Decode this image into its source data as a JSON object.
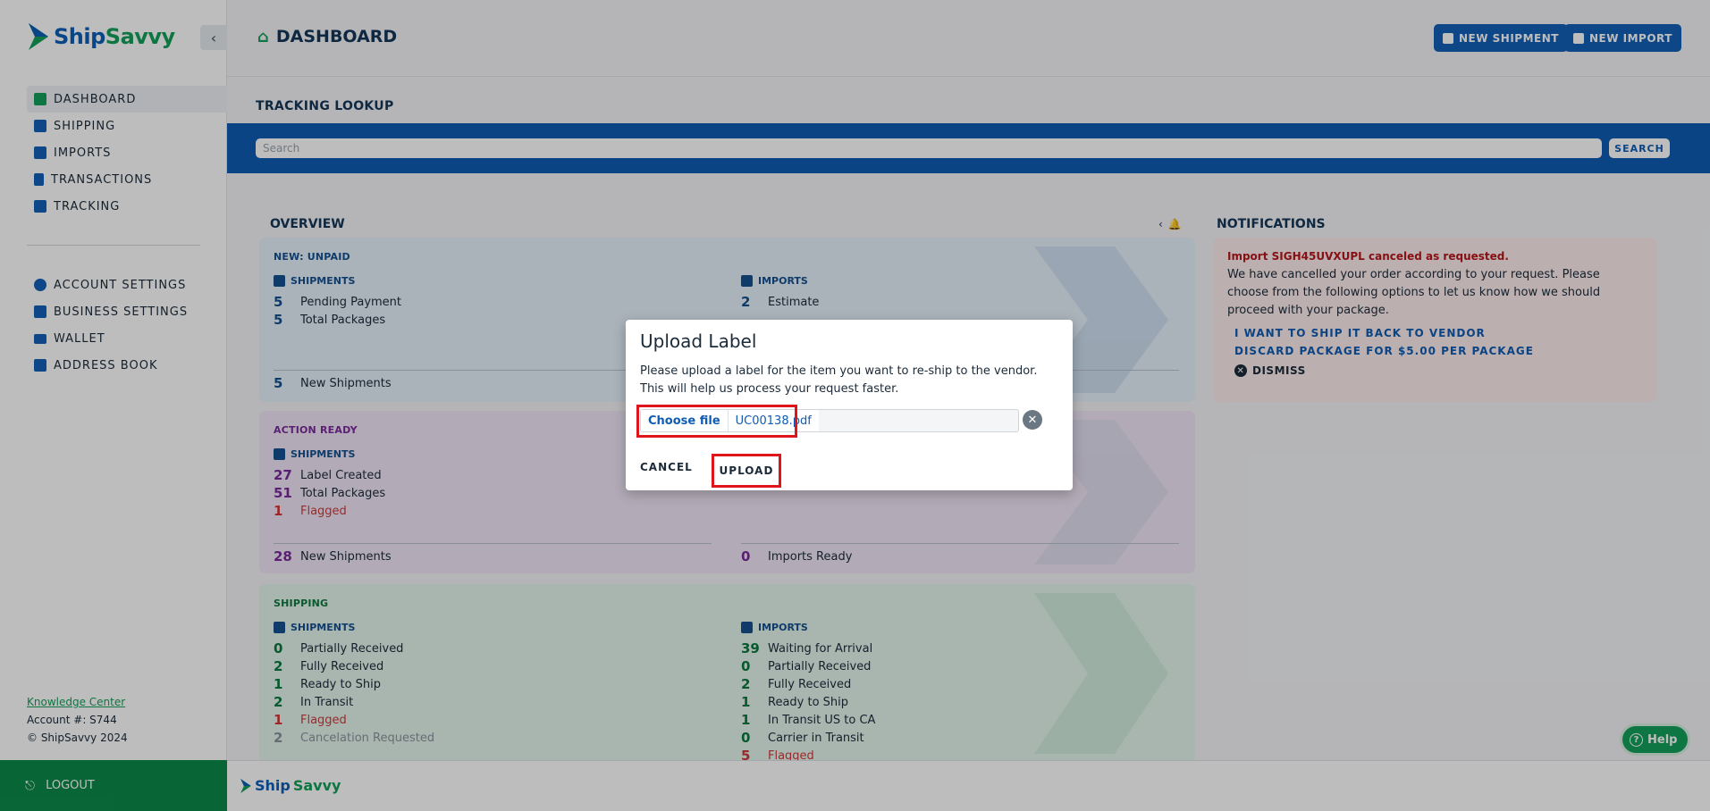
{
  "brand": {
    "name_part1": "Ship",
    "name_part2": "Savvy"
  },
  "sidebar": {
    "collapse_icon": "chevron-left-icon",
    "items": [
      {
        "label": "DASHBOARD",
        "icon": "home-icon"
      },
      {
        "label": "SHIPPING",
        "icon": "box-icon"
      },
      {
        "label": "IMPORTS",
        "icon": "import-box-icon"
      },
      {
        "label": "TRANSACTIONS",
        "icon": "document-icon"
      },
      {
        "label": "TRACKING",
        "icon": "tracking-box-icon"
      }
    ],
    "items2": [
      {
        "label": "ACCOUNT SETTINGS",
        "icon": "user-circle-icon"
      },
      {
        "label": "BUSINESS SETTINGS",
        "icon": "users-icon"
      },
      {
        "label": "WALLET",
        "icon": "wallet-icon"
      },
      {
        "label": "ADDRESS BOOK",
        "icon": "address-book-icon"
      }
    ],
    "knowledge_center": "Knowledge Center",
    "account": "Account #: S744",
    "copyright": "© ShipSavvy 2024",
    "logout": "LOGOUT"
  },
  "header": {
    "title": "DASHBOARD",
    "new_shipment": "NEW SHIPMENT",
    "new_import": "NEW IMPORT"
  },
  "tracking": {
    "title": "TRACKING LOOKUP",
    "placeholder": "Search",
    "search_label": "SEARCH"
  },
  "overview": {
    "title": "OVERVIEW",
    "unpaid": {
      "head": "NEW: UNPAID",
      "shipments_head": "SHIPMENTS",
      "imports_head": "IMPORTS",
      "shipments": [
        {
          "num": "5",
          "label": "Pending Payment"
        },
        {
          "num": "5",
          "label": "Total Packages"
        }
      ],
      "imports": [
        {
          "num": "2",
          "label": "Estimate"
        }
      ],
      "foot": {
        "num": "5",
        "label": "New Shipments"
      }
    },
    "ready": {
      "head": "ACTION READY",
      "shipments_head": "SHIPMENTS",
      "shipments": [
        {
          "num": "27",
          "label": "Label Created"
        },
        {
          "num": "51",
          "label": "Total Packages"
        },
        {
          "num": "1",
          "label": "Flagged"
        }
      ],
      "foot": {
        "num": "28",
        "label": "New Shipments"
      },
      "foot2": {
        "num": "0",
        "label": "Imports Ready"
      }
    },
    "shipping": {
      "head": "SHIPPING",
      "shipments_head": "SHIPMENTS",
      "imports_head": "IMPORTS",
      "shipments": [
        {
          "num": "0",
          "label": "Partially Received"
        },
        {
          "num": "2",
          "label": "Fully Received"
        },
        {
          "num": "1",
          "label": "Ready to Ship"
        },
        {
          "num": "2",
          "label": "In Transit"
        },
        {
          "num": "1",
          "label": "Flagged"
        },
        {
          "num": "2",
          "label": "Cancelation Requested"
        }
      ],
      "imports": [
        {
          "num": "39",
          "label": "Waiting for Arrival"
        },
        {
          "num": "0",
          "label": "Partially Received"
        },
        {
          "num": "2",
          "label": "Fully Received"
        },
        {
          "num": "1",
          "label": "Ready to Ship"
        },
        {
          "num": "1",
          "label": "In Transit US to CA"
        },
        {
          "num": "0",
          "label": "Carrier in Transit"
        },
        {
          "num": "5",
          "label": "Flagged"
        }
      ]
    }
  },
  "notifications": {
    "title": "NOTIFICATIONS",
    "head": "Import SIGH45UVXUPL canceled as requested.",
    "body": "We have cancelled your order according to your request. Please choose from the following options to let us know how we should proceed with your package.",
    "link1": "I WANT TO SHIP IT BACK TO VENDOR",
    "link2": "DISCARD PACKAGE FOR $5.00 PER PACKAGE",
    "dismiss": "DISMISS"
  },
  "help": "Help",
  "modal": {
    "title": "Upload Label",
    "text": "Please upload a label for the item you want to re-ship to the vendor. This will help us process your request faster.",
    "choose_file": "Choose file",
    "file_name": "UC00138.pdf",
    "cancel": "CANCEL",
    "upload": "UPLOAD"
  },
  "colors": {
    "brand_blue": "#1260b6",
    "brand_green": "#13a05a",
    "highlight_red": "#e0151b"
  }
}
